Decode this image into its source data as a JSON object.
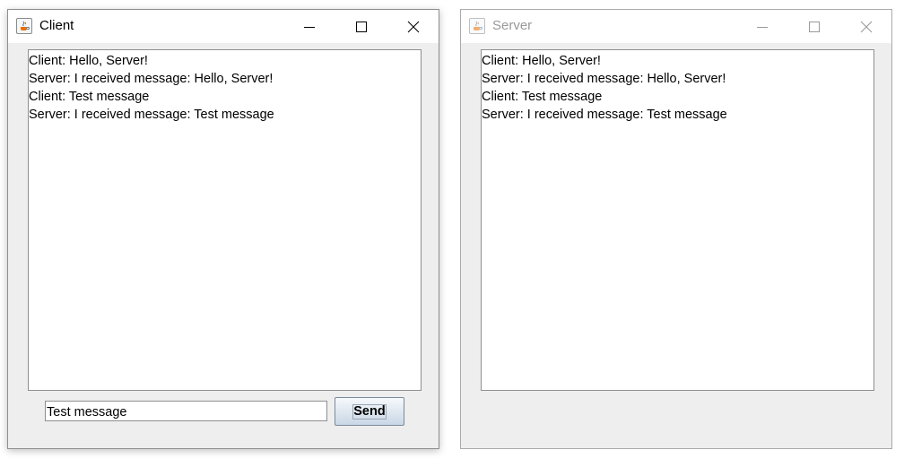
{
  "client_window": {
    "title": "Client",
    "icon": "java-cup-icon",
    "messages": [
      "Client: Hello, Server!",
      "Server: I received message: Hello, Server!",
      "Client: Test message",
      "Server: I received message: Test message"
    ],
    "input_value": "Test message",
    "send_label": "Send"
  },
  "server_window": {
    "title": "Server",
    "icon": "java-cup-icon",
    "messages": [
      "Client: Hello, Server!",
      "Server: I received message: Hello, Server!",
      "Client: Test message",
      "Server: I received message: Test message"
    ]
  },
  "colors": {
    "window_background": "#eeeeee",
    "inactive_title": "#999999",
    "border": "#8f8f8f"
  }
}
